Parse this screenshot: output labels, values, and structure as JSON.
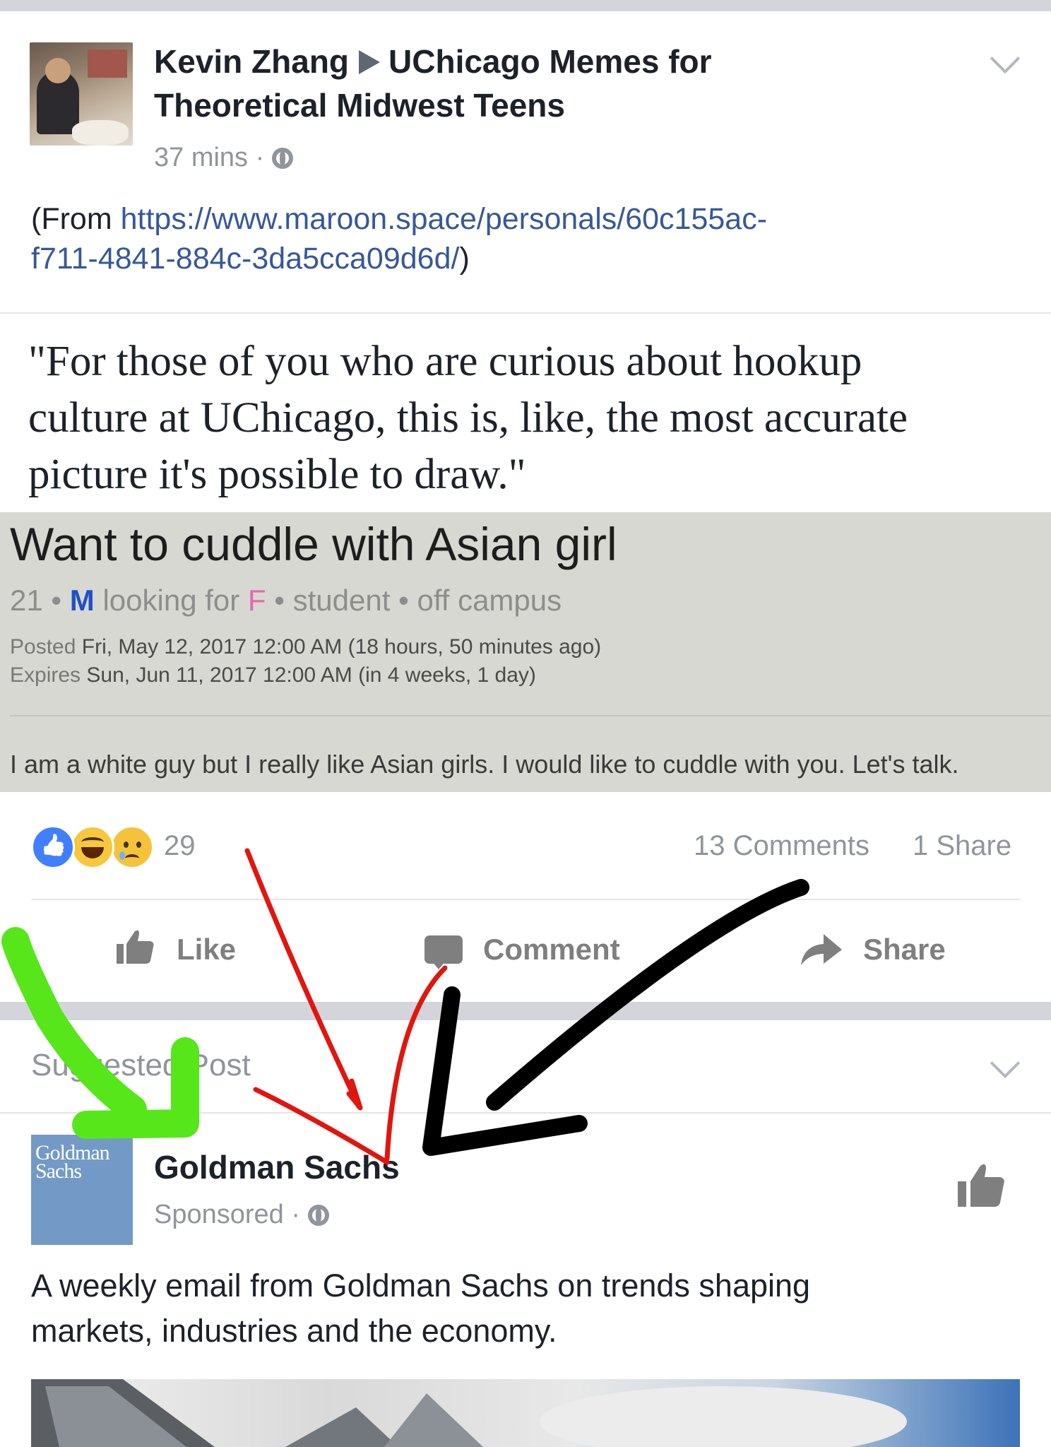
{
  "post": {
    "author": "Kevin Zhang",
    "group": "UChicago Memes for Theoretical Midwest Teens",
    "time": "37 mins",
    "dot": "·",
    "from_prefix": "(From ",
    "link_line1": "https://www.maroon.space/personals/60c155ac-",
    "link_line2": "f711-4841-884c-3da5cca09d6d/",
    "from_suffix": ")",
    "quote_line1": "\"For those of you who are curious about hookup",
    "quote_line2": "culture at UChicago, this is, like, the most accurate",
    "quote_line3": "picture it's possible to draw.\""
  },
  "personal_ad": {
    "title": "Want to cuddle with Asian girl",
    "age": "21",
    "sep": "•",
    "gender_self": "M",
    "looking": "looking for",
    "gender_target": "F",
    "role": "student",
    "location": "off campus",
    "posted_label": "Posted",
    "posted_value": "Fri, May 12, 2017 12:00 AM (18 hours, 50 minutes ago)",
    "expires_label": "Expires",
    "expires_value": "Sun, Jun 11, 2017 12:00 AM (in 4 weeks, 1 day)",
    "body": "I am a white guy but I really like Asian girls. I would like to cuddle with you. Let's talk."
  },
  "stats": {
    "reactions_count": "29",
    "comments": "13 Comments",
    "shares": "1 Share"
  },
  "actions": {
    "like": "Like",
    "comment": "Comment",
    "share": "Share"
  },
  "suggested": {
    "header": "Suggested Post",
    "logo_line1": "Goldman",
    "logo_line2": "Sachs",
    "page_name": "Goldman Sachs",
    "sponsored": "Sponsored",
    "dot": "·",
    "body_line1": "A weekly email from Goldman Sachs on trends shaping",
    "body_line2": "markets, industries and the economy."
  },
  "icons": {
    "reactions": [
      "like-icon",
      "haha-icon",
      "sad-icon"
    ],
    "privacy": "globe-icon",
    "menu": "chevron-down-icon"
  },
  "colors": {
    "link": "#365899",
    "like_reaction": "#4080ff",
    "gs_brand": "#7399c6",
    "arrow_green": "#57e619",
    "arrow_red": "#e0160f",
    "arrow_black": "#000000"
  }
}
